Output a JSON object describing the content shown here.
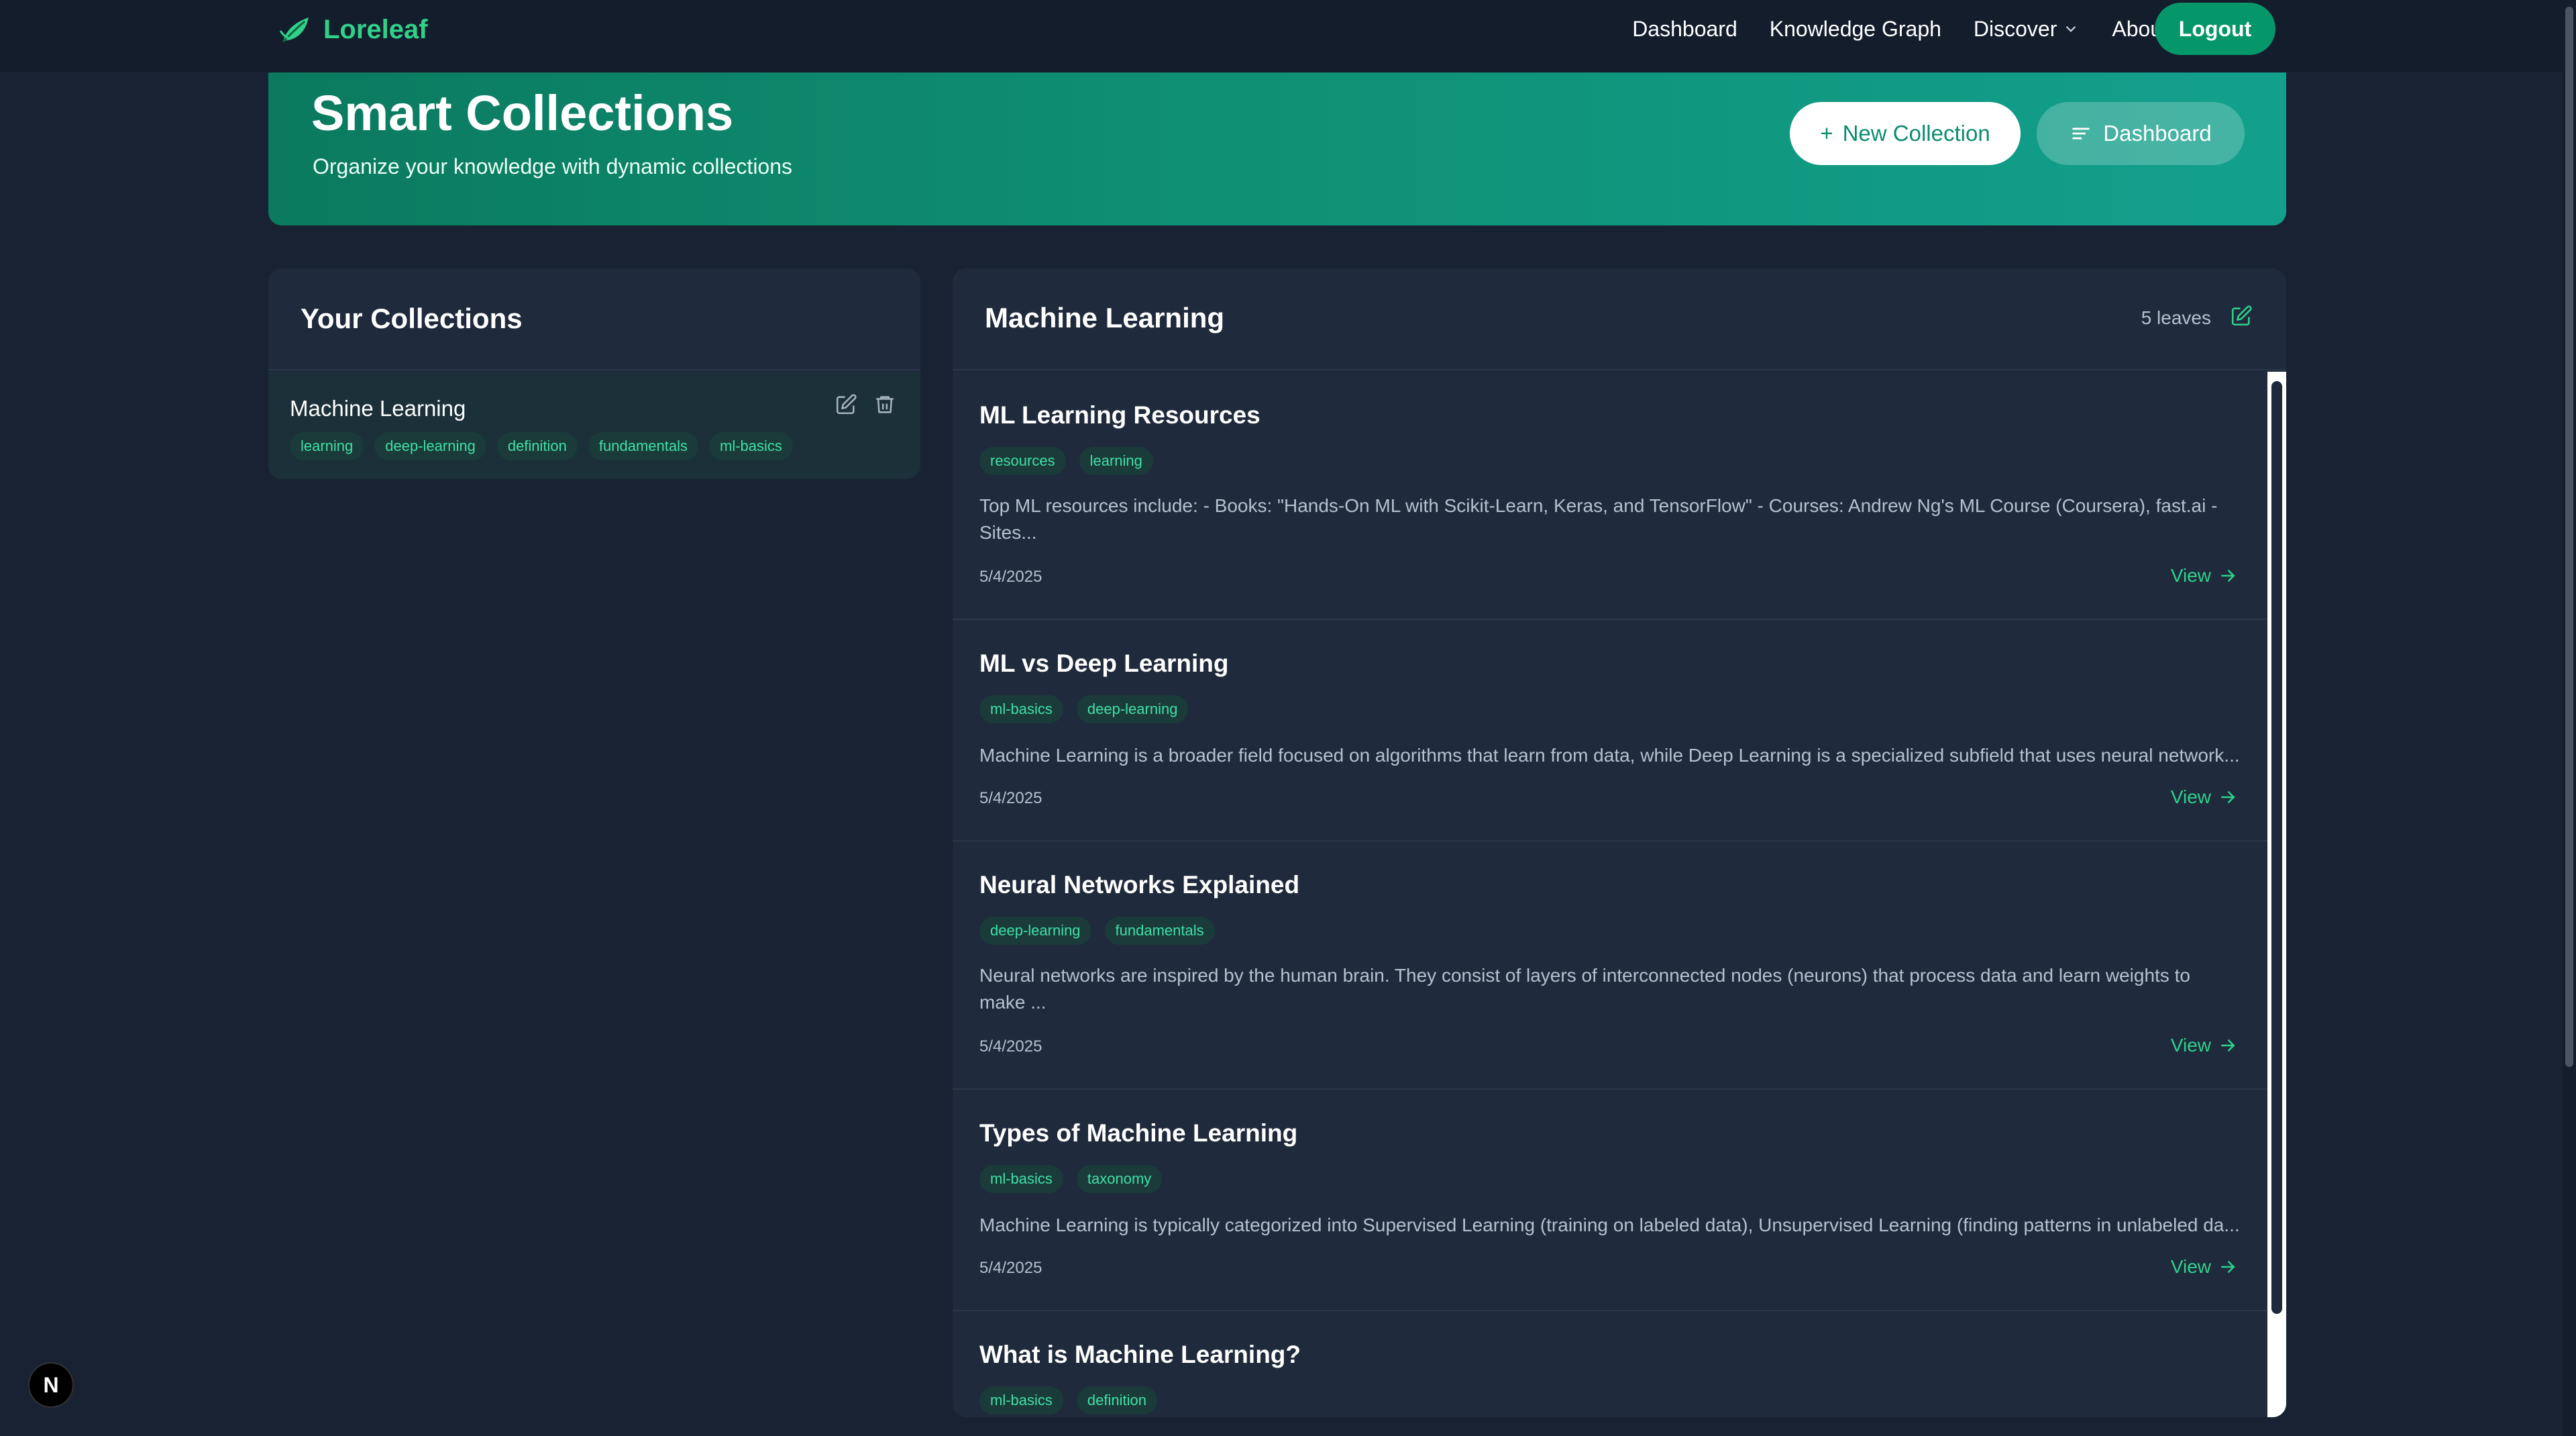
{
  "brand": {
    "name": "Loreleaf",
    "logo_icon": "leaf-icon"
  },
  "nav": {
    "links": [
      "Dashboard",
      "Knowledge Graph",
      "Discover",
      "About"
    ],
    "logout": "Logout"
  },
  "hero": {
    "title": "Smart Collections",
    "subtitle": "Organize your knowledge with dynamic collections",
    "new_collection": "New Collection",
    "new_collection_prefix": "+",
    "dashboard": "Dashboard"
  },
  "collections": {
    "title": "Your Collections",
    "items": [
      {
        "name": "Machine Learning",
        "tags": [
          "learning",
          "deep-learning",
          "definition",
          "fundamentals",
          "ml-basics"
        ]
      }
    ]
  },
  "selected": {
    "title": "Machine Learning",
    "count": "5 leaves",
    "leaves": [
      {
        "title": "ML Learning Resources",
        "tags": [
          "resources",
          "learning"
        ],
        "text_lines": [
          "Top ML resources include: - Books: \"Hands-On ML with Scikit-Learn, Keras, and TensorFlow\" - Courses: Andrew Ng's ML Course (Coursera), fast.ai -",
          "Sites..."
        ],
        "date": "5/4/2025",
        "view": "View"
      },
      {
        "title": "ML vs Deep Learning",
        "tags": [
          "ml-basics",
          "deep-learning"
        ],
        "text_lines": [
          "Machine Learning is a broader field focused on algorithms that learn from data, while Deep Learning is a specialized subfield that uses neural network..."
        ],
        "date": "5/4/2025",
        "view": "View"
      },
      {
        "title": "Neural Networks Explained",
        "tags": [
          "deep-learning",
          "fundamentals"
        ],
        "text_lines": [
          "Neural networks are inspired by the human brain. They consist of layers of interconnected nodes (neurons) that process data and learn weights to",
          "make ..."
        ],
        "date": "5/4/2025",
        "view": "View"
      },
      {
        "title": "Types of Machine Learning",
        "tags": [
          "ml-basics",
          "taxonomy"
        ],
        "text_lines": [
          "Machine Learning is typically categorized into Supervised Learning (training on labeled data), Unsupervised Learning (finding patterns in unlabeled da..."
        ],
        "date": "5/4/2025",
        "view": "View"
      },
      {
        "title": "What is Machine Learning?",
        "tags": [
          "ml-basics",
          "definition"
        ],
        "text_lines": [],
        "date": "",
        "view": ""
      }
    ]
  },
  "badge": {
    "label": "N"
  },
  "colors": {
    "accent": "#2fd18a",
    "background": "#182233",
    "panel": "#1f2a3c",
    "hero_start": "#0b7a5f",
    "hero_end": "#12a08d",
    "logout": "#059669"
  }
}
